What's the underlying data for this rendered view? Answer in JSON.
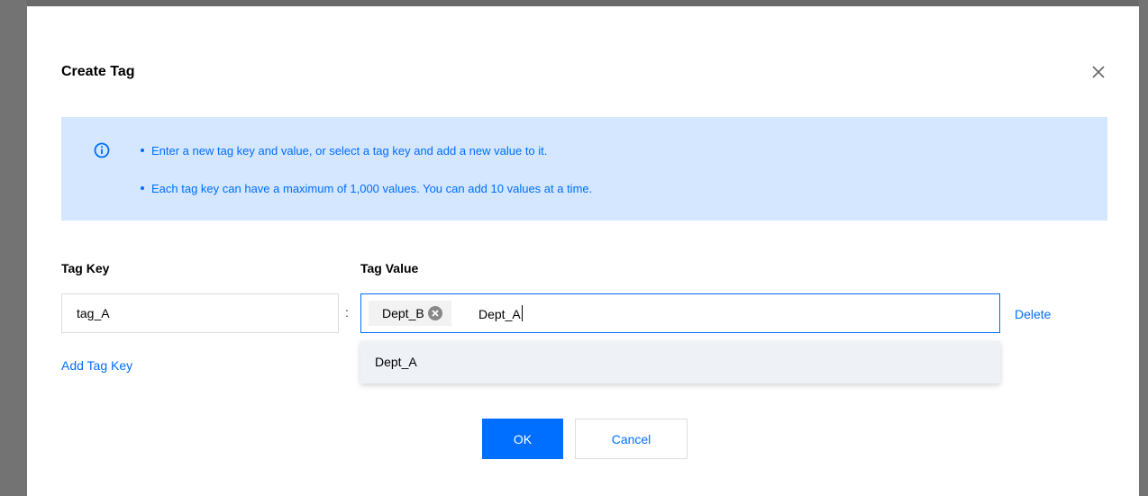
{
  "dialog": {
    "title": "Create Tag",
    "close_icon": "close-icon"
  },
  "notice": {
    "icon": "info-icon",
    "lines": [
      "Enter a new tag key and value, or select a tag key and add a new value to it.",
      "Each tag key can have a maximum of 1,000 values. You can add 10 values at a time."
    ]
  },
  "form": {
    "key_label": "Tag Key",
    "value_label": "Tag Value",
    "key_value": "tag_A",
    "separator": ":",
    "chips": [
      "Dept_B"
    ],
    "typed_value": "Dept_A",
    "delete_label": "Delete",
    "add_key_label": "Add Tag Key"
  },
  "dropdown": {
    "items": [
      "Dept_A"
    ]
  },
  "buttons": {
    "ok_label": "OK",
    "cancel_label": "Cancel"
  },
  "colors": {
    "accent": "#006eff",
    "notice_bg": "#d5e7ff",
    "overlay": "#6f6f6f"
  }
}
